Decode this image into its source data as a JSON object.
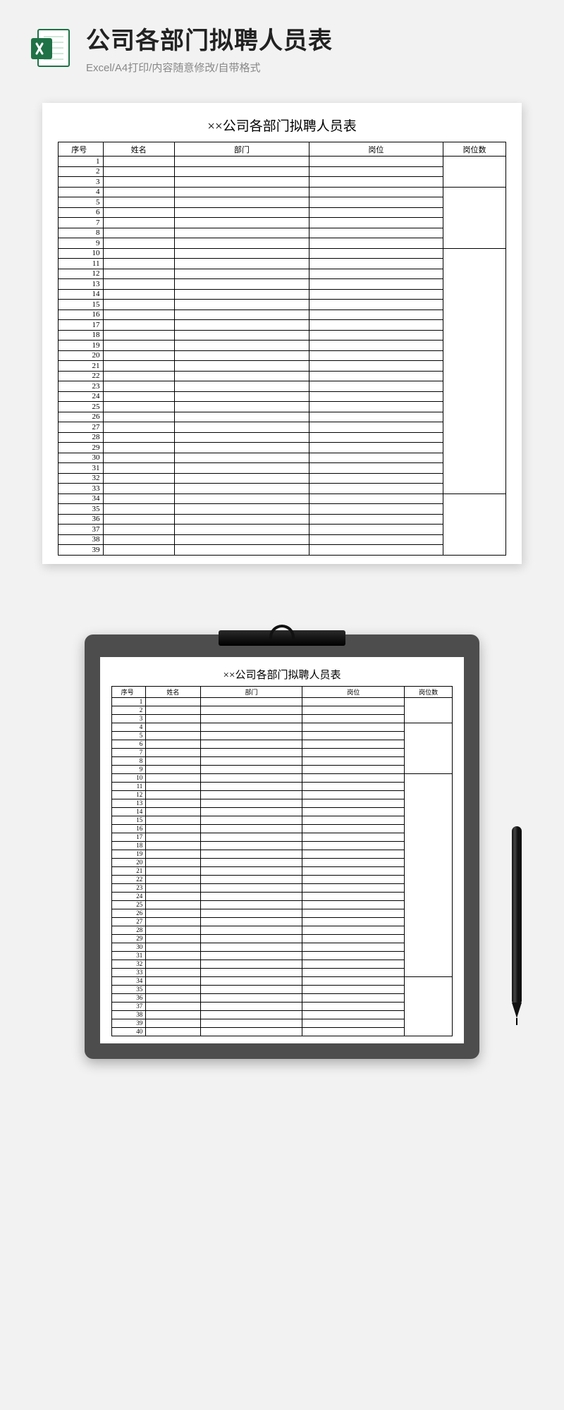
{
  "header": {
    "title": "公司各部门拟聘人员表",
    "subtitle": "Excel/A4打印/内容随意修改/自带格式"
  },
  "sheet": {
    "title_prefix": "××",
    "title": "公司各部门拟聘人员表",
    "columns": {
      "seq": "序号",
      "name": "姓名",
      "dept": "部门",
      "post": "岗位",
      "count": "岗位数"
    },
    "row_count_card1": 39,
    "row_count_card2": 40,
    "count_merge_groups_card1": [
      {
        "start": 1,
        "end": 3
      },
      {
        "start": 4,
        "end": 9
      },
      {
        "start": 10,
        "end": 33
      },
      {
        "start": 34,
        "end": 39
      }
    ],
    "count_merge_groups_card2": [
      {
        "start": 1,
        "end": 3
      },
      {
        "start": 4,
        "end": 9
      },
      {
        "start": 10,
        "end": 33
      },
      {
        "start": 34,
        "end": 40
      }
    ]
  }
}
